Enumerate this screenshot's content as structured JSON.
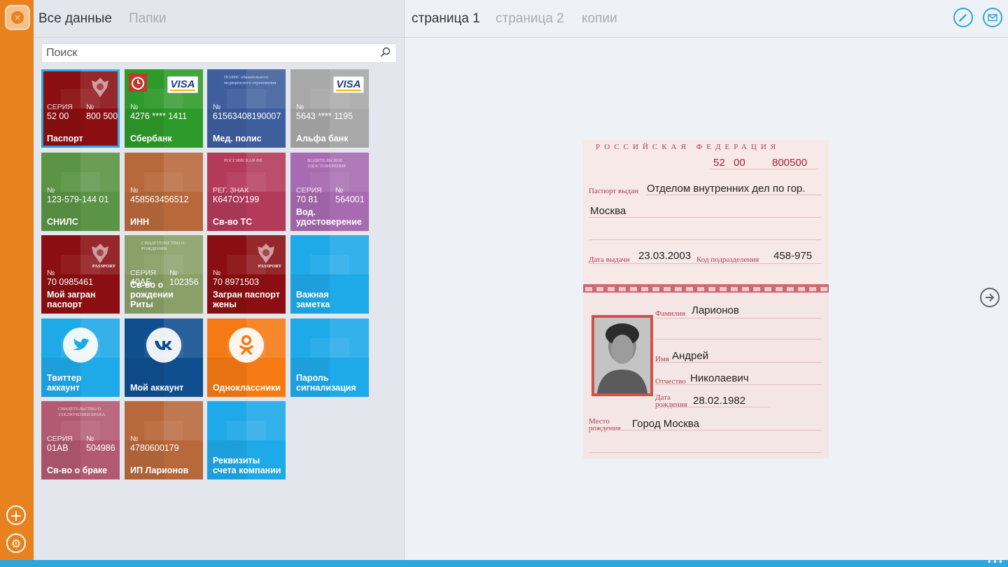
{
  "left_header": {
    "tab_all": "Все данные",
    "tab_folders": "Папки"
  },
  "search": {
    "placeholder": "Поиск"
  },
  "tiles": [
    {
      "f1_label": "СЕРИЯ",
      "f1_value": "52 00",
      "f2_label": "№",
      "f2_value": "800 500",
      "title": "Паспорт",
      "color": "#8b0f12"
    },
    {
      "f1_label": "№",
      "f1_value": "4276 **** 1411",
      "title": "Сбербанк",
      "badge": "VISA",
      "color": "#2e9a2b"
    },
    {
      "f1_label": "№",
      "f1_value": "61563408190007",
      "title": "Мед. полис",
      "card_text": "ПОЛИС обязательного медицинского страхования",
      "color": "#3e5e9e"
    },
    {
      "f1_label": "№",
      "f1_value": "5643 **** 1195",
      "title": "Альфа банк",
      "badge": "VISA",
      "color": "#a8a8a8"
    },
    {
      "f1_label": "№",
      "f1_value": "123-579-144 01",
      "title": "СНИЛС",
      "color": "#5a9444"
    },
    {
      "f1_label": "№",
      "f1_value": "458563456512",
      "title": "ИНН",
      "color": "#b8693c"
    },
    {
      "f1_label": "РЕГ. ЗНАК",
      "f1_value": "К647ОУ199",
      "title": "Св-во ТС",
      "card_text": "РОССИЙСКАЯ ФЕ",
      "color": "#b43a5a"
    },
    {
      "f1_label": "СЕРИЯ",
      "f1_value": "70 81",
      "f2_label": "№",
      "f2_value": "564001",
      "title": "Вод. удостоверение",
      "card_text": "ВОДИТЕЛЬСКОЕ УДОСТОВЕРЕНИЕ",
      "color": "#a86ab0"
    },
    {
      "f1_label": "№",
      "f1_value": "70 0985461",
      "title": "Мой загран паспорт",
      "pass_label": "PASSPORT",
      "color": "#8b0f12"
    },
    {
      "f1_label": "СЕРИЯ",
      "f1_value": "40АБ",
      "f2_label": "№",
      "f2_value": "102356",
      "title": "Св-во о рождении Риты",
      "card_text": "СВИДЕТЕЛЬСТВО О РОЖДЕНИИ",
      "color": "#8aa068"
    },
    {
      "f1_label": "№",
      "f1_value": "70 8971503",
      "title": "Загран паспорт жены",
      "pass_label": "PASSPORT",
      "color": "#8b0f12"
    },
    {
      "title": "Важная заметка",
      "color": "#1ea9e8"
    },
    {
      "title": "Твиттер аккаунт",
      "color": "#1ea9e8"
    },
    {
      "title": "Мой аккаунт",
      "color": "#0f4f8f"
    },
    {
      "title": "Одноклассники",
      "color": "#f57a14"
    },
    {
      "title": "Пароль сигнализация",
      "color": "#1ea9e8"
    },
    {
      "f1_label": "СЕРИЯ",
      "f1_value": "01АВ",
      "f2_label": "№",
      "f2_value": "504986",
      "title": "Св-во о браке",
      "card_text": "СВИДЕТЕЛЬСТВО О ЗАКЛЮЧЕНИИ БРАКА",
      "color": "#b25a72"
    },
    {
      "f1_label": "№",
      "f1_value": "4780600179",
      "title": "ИП Ларионов",
      "color": "#b8693c"
    },
    {
      "title": "Реквизиты счета компании",
      "color": "#1ea9e8"
    }
  ],
  "right_header": {
    "tab_page1": "страница 1",
    "tab_page2": "страница 2",
    "tab_copies": "копии"
  },
  "passport": {
    "country": "РОССИЙСКАЯ ФЕДЕРАЦИЯ",
    "series_a": "52",
    "series_b": "00",
    "number": "800500",
    "issued_by_label": "Паспорт выдан",
    "issued_by_line1": "Отделом внутренних дел по гор.",
    "issued_by_line2": "Москва",
    "issue_date_label": "Дата выдачи",
    "issue_date": "23.03.2003",
    "dept_code_label": "Код подразделения",
    "dept_code": "458-975",
    "surname_label": "Фамилия",
    "surname": "Ларионов",
    "name_label": "Имя",
    "name": "Андрей",
    "patronymic_label": "Отчество",
    "patronymic": "Николаевич",
    "birth_date_label_1": "Дата",
    "birth_date_label_2": "рождения",
    "birth_date": "28.02.1982",
    "birth_place_label_1": "Место",
    "birth_place_label_2": "рождения",
    "birth_place": "Город Москва"
  },
  "colors": {
    "accent": "#2da7e0",
    "rail": "#e8821e"
  }
}
